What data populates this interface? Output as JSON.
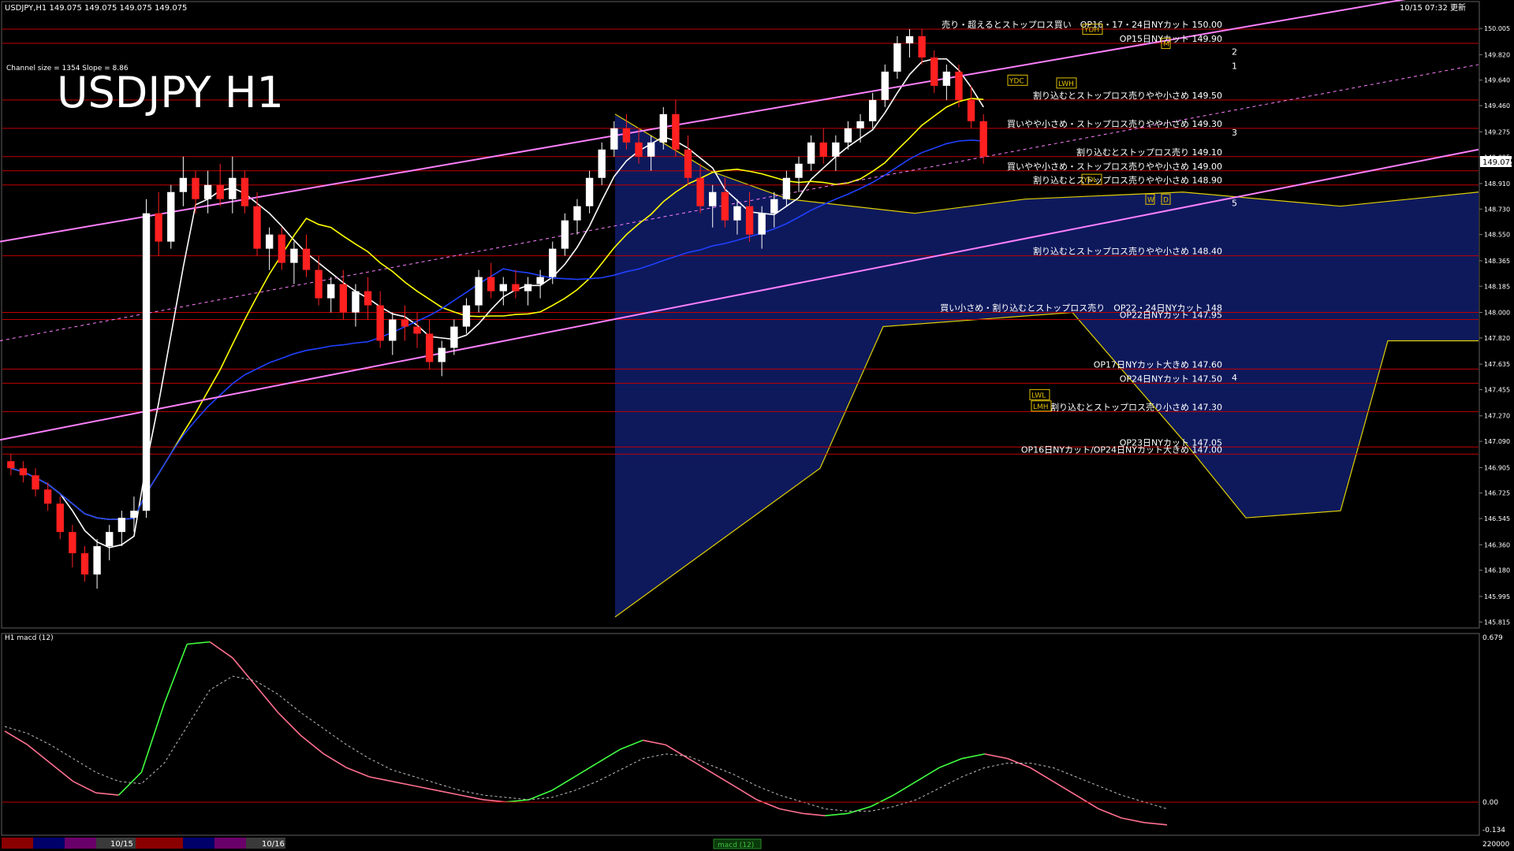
{
  "header": {
    "symbol_line": "USDJPY,H1  149.075 149.075 149.075 149.075",
    "timestamp": "10/15 07:32 更新",
    "channel_info": "Channel size = 1354 Slope = 8.86",
    "big_title": "USDJPY H1"
  },
  "sub_panel": {
    "label": "H1  macd (12)",
    "scale_top": "0.679",
    "scale_zero": "0.00",
    "scale_bottom": "-0.134",
    "scale_vol": "220000"
  },
  "price_badge": "149.075",
  "bottom_bar": {
    "date_1": "10/15",
    "date_2": "10/16",
    "tab_label": "macd (12)"
  },
  "colors": {
    "bull": "#ffffff",
    "bear": "#ff2020",
    "resistance_line": "#c00000",
    "channel": "#ff80ff",
    "ma_fast": "#ffffff",
    "ma_mid": "#ffff00",
    "ma_slow": "#2040ff",
    "cloud_blue": "#1a2ea8",
    "cloud_lines": "#e0d000",
    "macd_up": "#40ff40",
    "macd_down": "#ff7090",
    "signal": "#c0c0c0"
  },
  "chart_data": {
    "type": "line",
    "title": "USDJPY H1",
    "price_axis_ticks": [
      "150.005",
      "149.820",
      "149.640",
      "149.460",
      "149.275",
      "149.095",
      "148.910",
      "148.730",
      "148.550",
      "148.365",
      "148.185",
      "148.000",
      "147.820",
      "147.635",
      "147.455",
      "147.270",
      "147.090",
      "146.905",
      "146.725",
      "146.545",
      "146.360",
      "146.180",
      "145.995",
      "145.815"
    ],
    "ylim": [
      145.8,
      150.05
    ],
    "level_lines": [
      {
        "price": 150.0,
        "label": "売り・超えるとストップロス買い　OP16・17・24日NYカット 150.00"
      },
      {
        "price": 149.9,
        "label": "OP15日NYカット 149.90"
      },
      {
        "price": 149.5,
        "label": "割り込むとストップロス売りやや小さめ 149.50"
      },
      {
        "price": 149.3,
        "label": "買いやや小さめ・ストップロス売りやや小さめ 149.30"
      },
      {
        "price": 149.1,
        "label": "割り込むとストップロス売り 149.10"
      },
      {
        "price": 149.0,
        "label": "買いやや小さめ・ストップロス売りやや小さめ 149.00"
      },
      {
        "price": 148.9,
        "label": "割り込むとストップロス売りやや小さめ 148.90"
      },
      {
        "price": 148.4,
        "label": "割り込むとストップロス売りやや小さめ 148.40"
      },
      {
        "price": 148.0,
        "label": "買い小さめ・割り込むとストップロス売り　OP22・24日NYカット 148"
      },
      {
        "price": 147.95,
        "label": "OP22日NYカット 147.95"
      },
      {
        "price": 147.6,
        "label": "OP17日NYカット大きめ 147.60"
      },
      {
        "price": 147.5,
        "label": "OP24日NYカット 147.50"
      },
      {
        "price": 147.3,
        "label": "割り込むとストップロス売り小さめ 147.30"
      },
      {
        "price": 147.05,
        "label": "OP23日NYカット 147.05"
      },
      {
        "price": 147.0,
        "label": "OP16日NYカット/OP24日NYカット大きめ 147.00"
      }
    ],
    "wave_labels": [
      "1",
      "2",
      "3",
      "4",
      "5"
    ],
    "box_labels": [
      "YDH",
      "YDC",
      "YDL",
      "LWH",
      "LWL",
      "LMH",
      "W",
      "D",
      "M"
    ],
    "candles_ohlc": [
      [
        146.95,
        147.0,
        146.85,
        146.9
      ],
      [
        146.9,
        146.95,
        146.8,
        146.85
      ],
      [
        146.85,
        146.9,
        146.7,
        146.75
      ],
      [
        146.75,
        146.8,
        146.6,
        146.65
      ],
      [
        146.65,
        146.7,
        146.4,
        146.45
      ],
      [
        146.45,
        146.5,
        146.2,
        146.3
      ],
      [
        146.3,
        146.35,
        146.1,
        146.15
      ],
      [
        146.15,
        146.4,
        146.05,
        146.35
      ],
      [
        146.35,
        146.5,
        146.25,
        146.45
      ],
      [
        146.45,
        146.6,
        146.35,
        146.55
      ],
      [
        146.55,
        146.7,
        146.45,
        146.6
      ],
      [
        146.6,
        148.8,
        146.55,
        148.7
      ],
      [
        148.7,
        148.85,
        148.4,
        148.5
      ],
      [
        148.5,
        148.9,
        148.45,
        148.85
      ],
      [
        148.85,
        149.1,
        148.75,
        148.95
      ],
      [
        148.95,
        149.0,
        148.7,
        148.8
      ],
      [
        148.8,
        149.0,
        148.7,
        148.9
      ],
      [
        148.9,
        149.05,
        148.75,
        148.8
      ],
      [
        148.8,
        149.1,
        148.7,
        148.95
      ],
      [
        148.95,
        149.0,
        148.7,
        148.75
      ],
      [
        148.75,
        148.85,
        148.4,
        148.45
      ],
      [
        148.45,
        148.6,
        148.3,
        148.55
      ],
      [
        148.55,
        148.6,
        148.3,
        148.35
      ],
      [
        148.35,
        148.5,
        148.2,
        148.45
      ],
      [
        148.45,
        148.55,
        148.25,
        148.3
      ],
      [
        148.3,
        148.4,
        148.05,
        148.1
      ],
      [
        148.1,
        148.25,
        148.0,
        148.2
      ],
      [
        148.2,
        148.3,
        147.95,
        148.0
      ],
      [
        148.0,
        148.2,
        147.9,
        148.15
      ],
      [
        148.15,
        148.25,
        147.95,
        148.05
      ],
      [
        148.05,
        148.15,
        147.75,
        147.8
      ],
      [
        147.8,
        148.0,
        147.7,
        147.95
      ],
      [
        147.95,
        148.05,
        147.8,
        147.9
      ],
      [
        147.9,
        148.0,
        147.75,
        147.85
      ],
      [
        147.85,
        147.95,
        147.6,
        147.65
      ],
      [
        147.65,
        147.8,
        147.55,
        147.75
      ],
      [
        147.75,
        147.95,
        147.7,
        147.9
      ],
      [
        147.9,
        148.1,
        147.85,
        148.05
      ],
      [
        148.05,
        148.3,
        148.0,
        148.25
      ],
      [
        148.25,
        148.35,
        148.1,
        148.15
      ],
      [
        148.15,
        148.25,
        148.05,
        148.2
      ],
      [
        148.2,
        148.3,
        148.1,
        148.15
      ],
      [
        148.15,
        148.25,
        148.05,
        148.2
      ],
      [
        148.2,
        148.3,
        148.1,
        148.25
      ],
      [
        148.25,
        148.5,
        148.2,
        148.45
      ],
      [
        148.45,
        148.7,
        148.4,
        148.65
      ],
      [
        148.65,
        148.8,
        148.55,
        148.75
      ],
      [
        148.75,
        149.0,
        148.7,
        148.95
      ],
      [
        148.95,
        149.2,
        148.9,
        149.15
      ],
      [
        149.15,
        149.35,
        149.1,
        149.3
      ],
      [
        149.3,
        149.4,
        149.15,
        149.2
      ],
      [
        149.2,
        149.3,
        149.05,
        149.1
      ],
      [
        149.1,
        149.25,
        149.0,
        149.2
      ],
      [
        149.2,
        149.45,
        149.15,
        149.4
      ],
      [
        149.4,
        149.5,
        149.1,
        149.15
      ],
      [
        149.15,
        149.25,
        148.9,
        148.95
      ],
      [
        148.95,
        149.05,
        148.7,
        148.75
      ],
      [
        148.75,
        148.9,
        148.6,
        148.85
      ],
      [
        148.85,
        148.95,
        148.6,
        148.65
      ],
      [
        148.65,
        148.8,
        148.55,
        148.75
      ],
      [
        148.75,
        148.85,
        148.5,
        148.55
      ],
      [
        148.55,
        148.75,
        148.45,
        148.7
      ],
      [
        148.7,
        148.85,
        148.6,
        148.8
      ],
      [
        148.8,
        149.0,
        148.75,
        148.95
      ],
      [
        148.95,
        149.1,
        148.85,
        149.05
      ],
      [
        149.05,
        149.25,
        149.0,
        149.2
      ],
      [
        149.2,
        149.3,
        149.05,
        149.1
      ],
      [
        149.1,
        149.25,
        149.0,
        149.2
      ],
      [
        149.2,
        149.35,
        149.15,
        149.3
      ],
      [
        149.3,
        149.4,
        149.2,
        149.35
      ],
      [
        149.35,
        149.55,
        149.3,
        149.5
      ],
      [
        149.5,
        149.75,
        149.45,
        149.7
      ],
      [
        149.7,
        149.95,
        149.65,
        149.9
      ],
      [
        149.9,
        150.0,
        149.8,
        149.95
      ],
      [
        149.95,
        150.0,
        149.75,
        149.8
      ],
      [
        149.8,
        149.85,
        149.55,
        149.6
      ],
      [
        149.6,
        149.75,
        149.5,
        149.7
      ],
      [
        149.7,
        149.75,
        149.45,
        149.5
      ],
      [
        149.5,
        149.6,
        149.3,
        149.35
      ],
      [
        149.35,
        149.4,
        149.05,
        149.1
      ]
    ],
    "macd_series": {
      "name": "macd (12)",
      "values": [
        0.28,
        0.22,
        0.14,
        0.06,
        0.01,
        0.0,
        0.1,
        0.4,
        0.66,
        0.67,
        0.6,
        0.48,
        0.36,
        0.26,
        0.18,
        0.12,
        0.08,
        0.06,
        0.04,
        0.02,
        0.0,
        -0.02,
        -0.03,
        -0.02,
        0.02,
        0.08,
        0.14,
        0.2,
        0.24,
        0.22,
        0.16,
        0.1,
        0.04,
        -0.02,
        -0.06,
        -0.08,
        -0.09,
        -0.08,
        -0.05,
        0.0,
        0.06,
        0.12,
        0.16,
        0.18,
        0.16,
        0.12,
        0.06,
        0.0,
        -0.06,
        -0.1,
        -0.12,
        -0.13
      ]
    },
    "signal_series": {
      "name": "signal",
      "values": [
        0.3,
        0.27,
        0.22,
        0.16,
        0.1,
        0.06,
        0.05,
        0.14,
        0.3,
        0.46,
        0.52,
        0.5,
        0.44,
        0.36,
        0.29,
        0.22,
        0.16,
        0.11,
        0.08,
        0.05,
        0.02,
        0.0,
        -0.01,
        -0.02,
        -0.01,
        0.02,
        0.06,
        0.11,
        0.16,
        0.18,
        0.17,
        0.13,
        0.09,
        0.04,
        0.0,
        -0.03,
        -0.06,
        -0.07,
        -0.07,
        -0.05,
        -0.02,
        0.03,
        0.08,
        0.12,
        0.14,
        0.14,
        0.12,
        0.08,
        0.04,
        0.0,
        -0.03,
        -0.06
      ]
    }
  }
}
